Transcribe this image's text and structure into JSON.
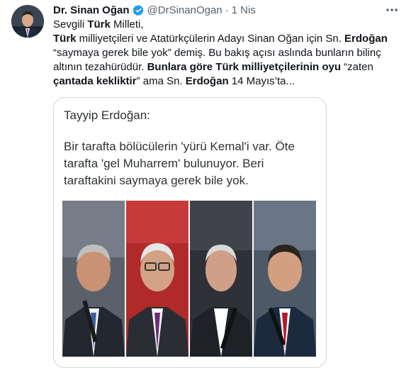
{
  "author": {
    "name": "Dr. Sinan Oğan",
    "handle": "@DrSinanOgan",
    "separator": "·",
    "date": "1 Nis",
    "verified_icon": "verified-badge-icon",
    "avatar_icon": "user-avatar"
  },
  "more_icon": "more-horizontal-icon",
  "tweet": {
    "l1_a": "Sevgili ",
    "l1_b": "Türk",
    "l1_c": " Milleti,",
    "l2_a": "Türk",
    "l2_b": " milliyetçileri ve Atatürkçülerin Adayı Sinan Oğan için Sn. ",
    "l2_c": "Erdoğan",
    "l3": "“saymaya gerek bile yok” demiş. Bu bakış açısı aslında bunların bilinç",
    "l4_a": "altının tezahürüdür. ",
    "l4_b": "Bunlara göre Türk milliyetçilerinin oyu",
    "l4_c": " “zaten",
    "l5_a": "çantada kekliktir",
    "l5_b": "” ama ",
    "l5_c": "Sn. ",
    "l5_d": "Erdoğan",
    "l5_e": " 14 Mayıs’ta..."
  },
  "quote": {
    "title": "Tayyip Erdoğan:",
    "body": "Bir tarafta bölücülerin 'yürü Kemal'i var. Öte tarafta 'gel Muharrem' bulunuyor. Beri taraftakini saymaya gerek bile yok.",
    "photos": [
      "portrait-1",
      "portrait-2",
      "portrait-3",
      "portrait-4"
    ]
  },
  "colors": {
    "accent": "#1d9bf0",
    "text": "#0f1419",
    "secondary": "#536471",
    "border": "#cfd9de"
  }
}
